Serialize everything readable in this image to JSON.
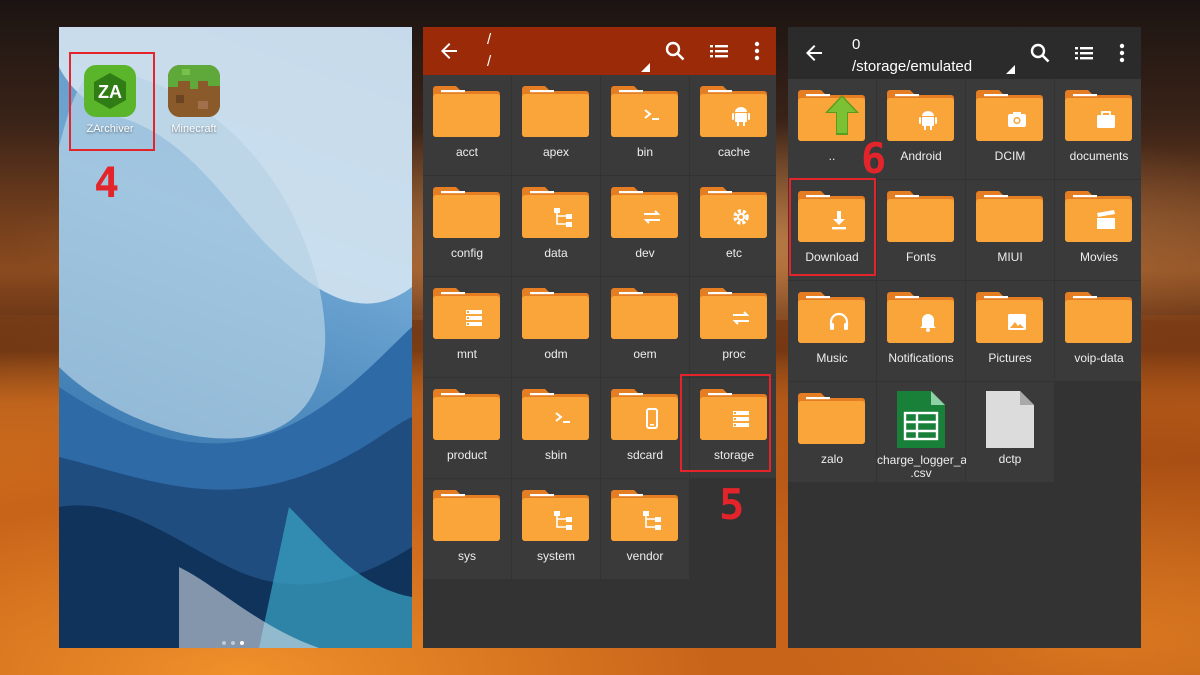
{
  "home": {
    "apps": [
      {
        "label": "ZArchiver",
        "icon": "zarchiver-app-icon"
      },
      {
        "label": "Minecraft",
        "icon": "minecraft-app-icon"
      }
    ]
  },
  "steps": [
    "4",
    "5",
    "6"
  ],
  "panel_root": {
    "path_top": "/",
    "path_bottom": "/",
    "toolbar_color": "#9a2a08",
    "folders": [
      {
        "name": "acct",
        "badge": ""
      },
      {
        "name": "apex",
        "badge": ""
      },
      {
        "name": "bin",
        "badge": "terminal-icon"
      },
      {
        "name": "cache",
        "badge": "android-icon"
      },
      {
        "name": "config",
        "badge": ""
      },
      {
        "name": "data",
        "badge": "tree-icon"
      },
      {
        "name": "dev",
        "badge": "swap-icon"
      },
      {
        "name": "etc",
        "badge": "gear-icon"
      },
      {
        "name": "mnt",
        "badge": "storage-icon"
      },
      {
        "name": "odm",
        "badge": ""
      },
      {
        "name": "oem",
        "badge": ""
      },
      {
        "name": "proc",
        "badge": "swap-icon"
      },
      {
        "name": "product",
        "badge": ""
      },
      {
        "name": "sbin",
        "badge": "terminal-icon"
      },
      {
        "name": "sdcard",
        "badge": "phone-icon"
      },
      {
        "name": "storage",
        "badge": "storage-icon"
      },
      {
        "name": "sys",
        "badge": ""
      },
      {
        "name": "system",
        "badge": "tree-icon"
      },
      {
        "name": "vendor",
        "badge": "tree-icon"
      }
    ]
  },
  "panel_storage": {
    "path_top": "0",
    "path_bottom": "/storage/emulated",
    "toolbar_color": "#2b2b2b",
    "items": [
      {
        "name": "..",
        "kind": "up"
      },
      {
        "name": "Android",
        "kind": "folder",
        "badge": "android-icon"
      },
      {
        "name": "DCIM",
        "kind": "folder",
        "badge": "camera-icon"
      },
      {
        "name": "documents",
        "kind": "folder",
        "badge": "briefcase-icon"
      },
      {
        "name": "Download",
        "kind": "folder",
        "badge": "download-icon"
      },
      {
        "name": "Fonts",
        "kind": "folder",
        "badge": ""
      },
      {
        "name": "MIUI",
        "kind": "folder",
        "badge": ""
      },
      {
        "name": "Movies",
        "kind": "folder",
        "badge": "clapper-icon"
      },
      {
        "name": "Music",
        "kind": "folder",
        "badge": "headphones-icon"
      },
      {
        "name": "Notifications",
        "kind": "folder",
        "badge": "bell-icon"
      },
      {
        "name": "Pictures",
        "kind": "folder",
        "badge": "image-icon"
      },
      {
        "name": "voip-data",
        "kind": "folder",
        "badge": ""
      },
      {
        "name": "zalo",
        "kind": "folder",
        "badge": ""
      },
      {
        "name": "charge_logger_a\n.csv",
        "kind": "csv"
      },
      {
        "name": "dctp",
        "kind": "file"
      }
    ]
  },
  "colors": {
    "folder": "#f9a53a",
    "folder_tab": "#e57d22",
    "highlight": "#e3252b"
  }
}
